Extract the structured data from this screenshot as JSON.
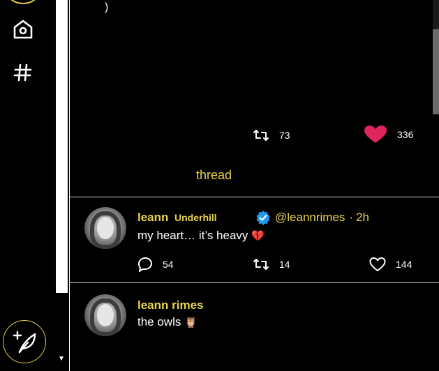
{
  "sidebar": {
    "nav": [
      {
        "name": "home",
        "icon": "home-icon"
      },
      {
        "name": "explore",
        "icon": "hashtag-icon"
      }
    ],
    "compose_icon": "feather-plus-icon"
  },
  "top_tweet": {
    "paren_mark": ")",
    "retweets": "73",
    "likes": "336",
    "thread_label": "thread"
  },
  "tweet1": {
    "name": "leann",
    "name_extra": "Underhill",
    "handle": "@leannrimes",
    "separator": "·",
    "time": "2h",
    "text": "my heart… it’s heavy",
    "emoji": "💔",
    "replies": "54",
    "retweets": "14",
    "likes": "144"
  },
  "tweet2": {
    "name": "leann rimes",
    "text": "the owls",
    "emoji": "🦉"
  },
  "colors": {
    "accent": "#e8d44d",
    "like_red": "#e0245e",
    "verified_blue": "#1d9bf0",
    "background": "#000000"
  }
}
